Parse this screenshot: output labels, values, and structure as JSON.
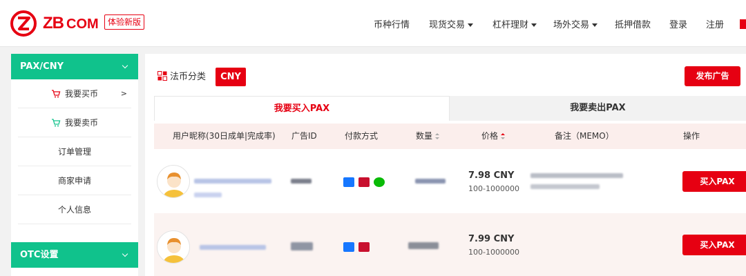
{
  "header": {
    "logo_text": "ZB",
    "logo_suffix": "COM",
    "badge": "体验新版",
    "nav": [
      "币种行情",
      "现货交易",
      "杠杆理财",
      "场外交易",
      "抵押借款",
      "登录",
      "注册"
    ]
  },
  "sidebar": {
    "section_title": "PAX/CNY",
    "items": [
      {
        "label": "我要买币",
        "arrow": ">"
      },
      {
        "label": "我要卖币"
      },
      {
        "label": "订单管理"
      },
      {
        "label": "商家申请"
      },
      {
        "label": "个人信息"
      }
    ],
    "otc_title": "OTC设置"
  },
  "main": {
    "category_label": "法币分类",
    "currency": "CNY",
    "publish_button": "发布广告",
    "tabs": {
      "buy": "我要买入PAX",
      "sell": "我要卖出PAX"
    },
    "columns": {
      "user": "用户昵称(30日成单|完成率)",
      "ad_id": "广告ID",
      "payment": "付款方式",
      "quantity": "数量",
      "price": "价格",
      "memo": "备注（MEMO）",
      "action": "操作"
    },
    "rows": [
      {
        "price": "7.98 CNY",
        "range": "100-1000000",
        "button": "买入PAX"
      },
      {
        "price": "7.99 CNY",
        "range": "100-1000000",
        "button": "买入PAX"
      }
    ]
  },
  "colors": {
    "brand_red": "#e60012",
    "green": "#10c28c",
    "row_pink": "#fbeeec"
  }
}
